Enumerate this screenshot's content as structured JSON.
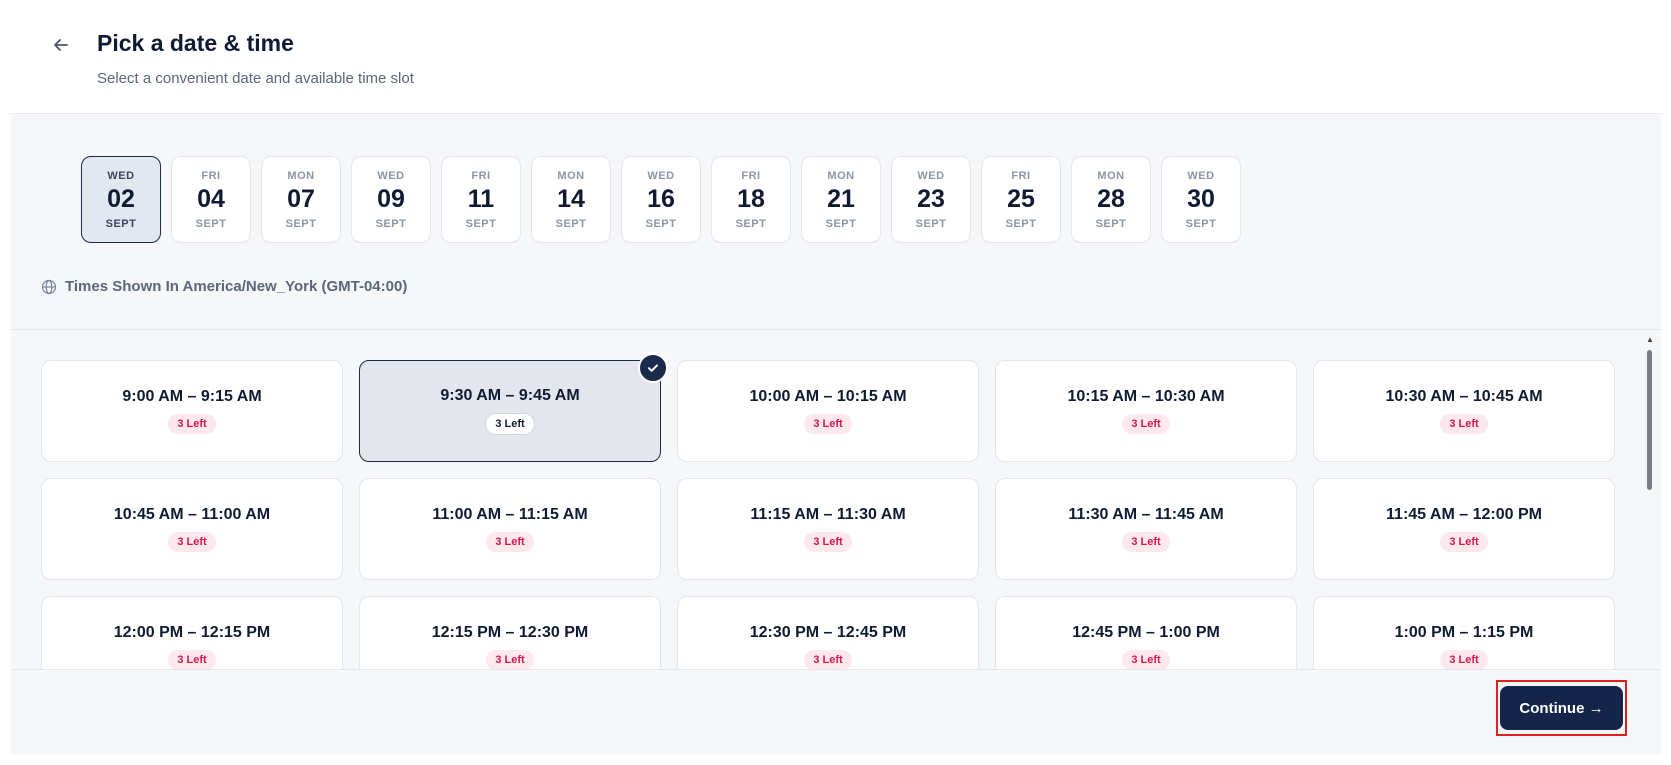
{
  "header": {
    "title": "Pick a date & time",
    "subtitle": "Select a convenient date and available time slot",
    "back_icon": "arrow-left-icon"
  },
  "dates": [
    {
      "dow": "WED",
      "day": "02",
      "month": "SEPT",
      "selected": true
    },
    {
      "dow": "FRI",
      "day": "04",
      "month": "SEPT"
    },
    {
      "dow": "MON",
      "day": "07",
      "month": "SEPT"
    },
    {
      "dow": "WED",
      "day": "09",
      "month": "SEPT"
    },
    {
      "dow": "FRI",
      "day": "11",
      "month": "SEPT"
    },
    {
      "dow": "MON",
      "day": "14",
      "month": "SEPT"
    },
    {
      "dow": "WED",
      "day": "16",
      "month": "SEPT"
    },
    {
      "dow": "FRI",
      "day": "18",
      "month": "SEPT"
    },
    {
      "dow": "MON",
      "day": "21",
      "month": "SEPT"
    },
    {
      "dow": "WED",
      "day": "23",
      "month": "SEPT"
    },
    {
      "dow": "FRI",
      "day": "25",
      "month": "SEPT"
    },
    {
      "dow": "MON",
      "day": "28",
      "month": "SEPT"
    },
    {
      "dow": "WED",
      "day": "30",
      "month": "SEPT"
    }
  ],
  "timezone": {
    "label": "Times Shown In America/New_York (GMT-04:00)",
    "icon": "globe-icon"
  },
  "slots": [
    {
      "time": "9:00 AM – 9:15 AM",
      "badge": "3 Left"
    },
    {
      "time": "9:30 AM – 9:45 AM",
      "badge": "3 Left",
      "selected": true
    },
    {
      "time": "10:00 AM – 10:15 AM",
      "badge": "3 Left"
    },
    {
      "time": "10:15 AM – 10:30 AM",
      "badge": "3 Left"
    },
    {
      "time": "10:30 AM – 10:45 AM",
      "badge": "3 Left"
    },
    {
      "time": "10:45 AM – 11:00 AM",
      "badge": "3 Left"
    },
    {
      "time": "11:00 AM – 11:15 AM",
      "badge": "3 Left"
    },
    {
      "time": "11:15 AM – 11:30 AM",
      "badge": "3 Left"
    },
    {
      "time": "11:30 AM – 11:45 AM",
      "badge": "3 Left"
    },
    {
      "time": "11:45 AM – 12:00 PM",
      "badge": "3 Left"
    },
    {
      "time": "12:00 PM – 12:15 PM",
      "badge": "3 Left"
    },
    {
      "time": "12:15 PM – 12:30 PM",
      "badge": "3 Left"
    },
    {
      "time": "12:30 PM – 12:45 PM",
      "badge": "3 Left"
    },
    {
      "time": "12:45 PM – 1:00 PM",
      "badge": "3 Left"
    },
    {
      "time": "1:00 PM – 1:15 PM",
      "badge": "3 Left"
    }
  ],
  "footer": {
    "continue_label": "Continue →"
  },
  "colors": {
    "primary": "#15254a",
    "badge_text": "#d6174f",
    "badge_bg": "#fde8ee",
    "highlight_border": "#e02020"
  }
}
